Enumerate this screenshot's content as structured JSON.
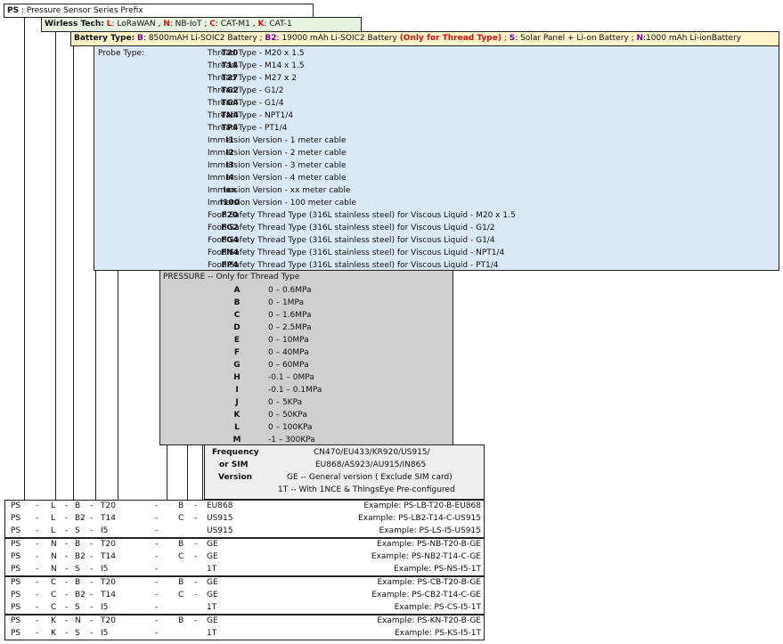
{
  "prefix": {
    "code": "PS",
    "label": " : Pressure Sensor Series Prefix"
  },
  "wireless": {
    "label": "Wirless Tech:",
    "options": [
      {
        "code": "L",
        "text": ": LoRaWAN , "
      },
      {
        "code": "N",
        "text": ": NB-IoT ; "
      },
      {
        "code": "C",
        "text": ": CAT-M1 , "
      },
      {
        "code": "K",
        "text": ": CAT-1"
      }
    ]
  },
  "battery": {
    "label": "Battery Type:",
    "b_code": "B",
    "b_text": ": 8500mAH Li-SOIC2 Battery ; ",
    "b2_code": "B2",
    "b2_text": ": 19000 mAh Li-SOIC2 Battery ",
    "b2_note": "(Only for Thread Type)",
    "sep": " ; ",
    "s_code": "S",
    "s_text": ": Solar Panel + Li-on Battery ; ",
    "n_code": "N",
    "n_text": ":1000 mAh Li-ionBattery"
  },
  "probe": {
    "label": "Probe Type:",
    "items": [
      {
        "code": "T20",
        "desc": "Thread Type - M20 x 1.5"
      },
      {
        "code": "T14",
        "desc": "Thread Type - M14 x 1.5"
      },
      {
        "code": "T27",
        "desc": "Thread Type - M27 x 2"
      },
      {
        "code": "TG2",
        "desc": "Thread Type - G1/2"
      },
      {
        "code": "TG4",
        "desc": "Thread Type - G1/4"
      },
      {
        "code": "TN4",
        "desc": "Thread Type - NPT1/4"
      },
      {
        "code": "TP4",
        "desc": "Thread Type - PT1/4"
      },
      {
        "code": "I1",
        "desc": "Immersion Version - 1 meter cable"
      },
      {
        "code": "I2",
        "desc": "Immersion Version - 2 meter cable"
      },
      {
        "code": "I3",
        "desc": "Immersion Version - 3 meter cable"
      },
      {
        "code": "I4",
        "desc": "Immersion Version - 4 meter cable"
      },
      {
        "code": "Ixx",
        "desc": "Immersion Version - xx meter cable"
      },
      {
        "code": "I100",
        "desc": "Immersion Version - 100 meter cable"
      },
      {
        "code": "F20",
        "desc": "Food Safety Thread Type (316L stainless steel) for Viscous Liquid - M20 x 1.5"
      },
      {
        "code": "FG2",
        "desc": "Food Safety Thread Type (316L stainless steel) for Viscous Liquid - G1/2"
      },
      {
        "code": "FG4",
        "desc": "Food Safety Thread Type (316L stainless steel) for Viscous Liquid - G1/4"
      },
      {
        "code": "FN4",
        "desc": "Food Safety Thread Type (316L stainless steel) for Viscous Liquid - NPT1/4"
      },
      {
        "code": "FP4",
        "desc": "Food Safety Thread Type (316L stainless steel) for Viscous Liquid - PT1/4"
      }
    ]
  },
  "pressure": {
    "label": "PRESSURE -- Only for Thread Type",
    "items": [
      {
        "code": "A",
        "value": "0 – 0.6MPa"
      },
      {
        "code": "B",
        "value": "0 – 1MPa"
      },
      {
        "code": "C",
        "value": "0 – 1.6MPa"
      },
      {
        "code": "D",
        "value": "0 – 2.5MPa"
      },
      {
        "code": "E",
        "value": "0 – 10MPa"
      },
      {
        "code": "F",
        "value": "0 – 40MPa"
      },
      {
        "code": "G",
        "value": "0 – 60MPa"
      },
      {
        "code": "H",
        "value": "-0.1 – 0MPa"
      },
      {
        "code": "I",
        "value": "-0.1 – 0.1MPa"
      },
      {
        "code": "J",
        "value": "0 – 5KPa"
      },
      {
        "code": "K",
        "value": "0 – 50KPa"
      },
      {
        "code": "L",
        "value": "0 – 100KPa"
      },
      {
        "code": "M",
        "value": "-1 – 300KPa"
      }
    ]
  },
  "frequency": {
    "label_line1": "Frequency",
    "label_line2": "or  SIM",
    "label_line3": "Version",
    "freq_line1": "CN470/EU433/KR920/US915/",
    "freq_line2": "EU868/AS923/AU915/IN865",
    "ge": "GE -- General version ( Exclude SIM card)",
    "one_t": "1T -- With 1NCE & ThingsEye Pre-configured"
  },
  "example_groups": [
    {
      "rows": [
        {
          "c1": "PS",
          "c2": "L",
          "c3": "B",
          "c4": "T20",
          "c5": "B",
          "c6": "EU868",
          "example": "Example: PS-LB-T20-B-EU868"
        },
        {
          "c1": "PS",
          "c2": "L",
          "c3": "B2",
          "c4": "T14",
          "c5": "C",
          "c6": "US915",
          "example": "Example: PS-LB2-T14-C-US915"
        },
        {
          "c1": "PS",
          "c2": "L",
          "c3": "S",
          "c4": "I5",
          "c5": "",
          "c6": "US915",
          "example": "Example: PS-LS-I5-US915"
        }
      ]
    },
    {
      "rows": [
        {
          "c1": "PS",
          "c2": "N",
          "c3": "B",
          "c4": "T20",
          "c5": "B",
          "c6": "GE",
          "example": "Example: PS-NB-T20-B-GE"
        },
        {
          "c1": "PS",
          "c2": "N",
          "c3": "B2",
          "c4": "T14",
          "c5": "C",
          "c6": "GE",
          "example": "Example: PS-NB2-T14-C-GE"
        },
        {
          "c1": "PS",
          "c2": "N",
          "c3": "S",
          "c4": "I5",
          "c5": "",
          "c6": "1T",
          "example": "Example: PS-NS-I5-1T"
        }
      ]
    },
    {
      "rows": [
        {
          "c1": "PS",
          "c2": "C",
          "c3": "B",
          "c4": "T20",
          "c5": "B",
          "c6": "GE",
          "example": "Example: PS-CB-T20-B-GE"
        },
        {
          "c1": "PS",
          "c2": "C",
          "c3": "B2",
          "c4": "T14",
          "c5": "C",
          "c6": "GE",
          "example": "Example: PS-CB2-T14-C-GE"
        },
        {
          "c1": "PS",
          "c2": "C",
          "c3": "S",
          "c4": "I5",
          "c5": "",
          "c6": "1T",
          "example": "Example: PS-CS-I5-1T"
        }
      ]
    },
    {
      "rows": [
        {
          "c1": "PS",
          "c2": "K",
          "c3": "N",
          "c4": "T20",
          "c5": "B",
          "c6": "GE",
          "example": "Example: PS-KN-T20-B-GE"
        },
        {
          "c1": "PS",
          "c2": "K",
          "c3": "S",
          "c4": "I5",
          "c5": "",
          "c6": "1T",
          "example": "Example: PS-KS-I5-1T"
        }
      ]
    }
  ],
  "separators": {
    "dash": "-"
  },
  "colors": {
    "probe_bg": "#dbe8f6",
    "pressure_bg": "#d0cfd0",
    "freq_bg": "#eeeeee",
    "wireless_bg": "#e6f3e0",
    "battery_bg": "#fdf2c8"
  }
}
